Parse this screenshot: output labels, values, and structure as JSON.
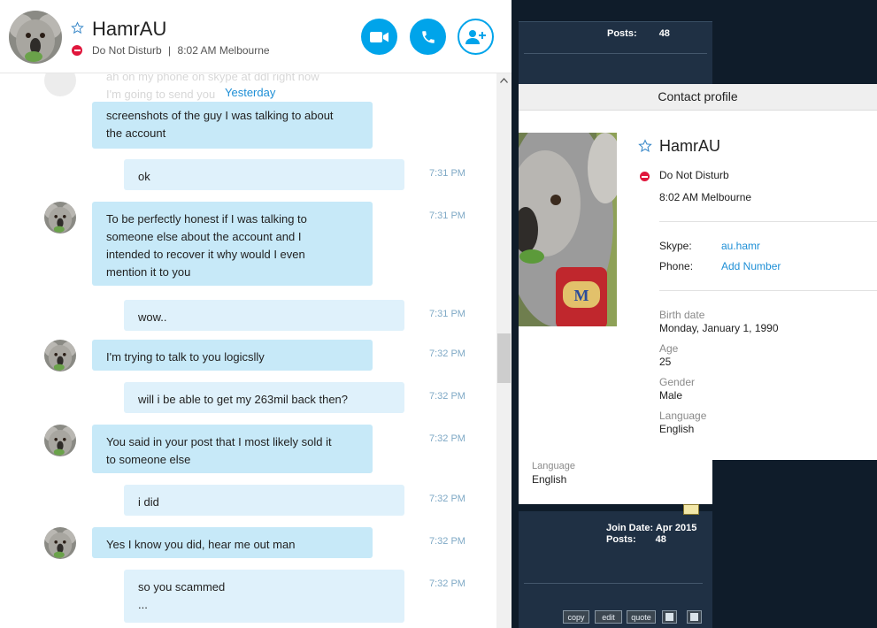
{
  "forum": {
    "top_posts_label": "Posts:",
    "top_posts_value": "48",
    "language_label": "Language",
    "language_value": "English",
    "join_date_label": "Join Date:",
    "join_date_value": "Apr 2015",
    "posts_label": "Posts:",
    "posts_value": "48",
    "buttons": [
      "copy",
      "edit",
      "quote"
    ]
  },
  "profile": {
    "header": "Contact profile",
    "name": "HamrAU",
    "status": "Do Not Disturb",
    "local_time": "8:02 AM Melbourne",
    "skype_label": "Skype:",
    "skype_value": "au.hamr",
    "phone_label": "Phone:",
    "phone_value": "Add Number",
    "birth_label": "Birth date",
    "birth_value": "Monday, January 1, 1990",
    "age_label": "Age",
    "age_value": "25",
    "gender_label": "Gender",
    "gender_value": "Male",
    "language_label": "Language",
    "language_value": "English"
  },
  "chat": {
    "contact_name": "HamrAU",
    "status": "Do Not Disturb",
    "local_time": "8:02 AM Melbourne",
    "status_separator": "|",
    "date_separator": "Yesterday",
    "faded_lines": [
      "ah on my phone on skype at ddl right now",
      "I'm going to send you"
    ],
    "messages": [
      {
        "dir": "in",
        "text": "screenshots of the guy I was talking to about\nthe account",
        "time": ""
      },
      {
        "dir": "out",
        "text": "ok",
        "time": "7:31 PM"
      },
      {
        "dir": "in",
        "text": "To be perfectly honest if I was talking to\nsomeone else about the account and I\nintended to recover it why would I even\nmention it to you",
        "time": "7:31 PM"
      },
      {
        "dir": "out",
        "text": "wow..",
        "time": "7:31 PM"
      },
      {
        "dir": "in",
        "text": "I'm trying to talk to you logicslly",
        "time": "7:32 PM"
      },
      {
        "dir": "out",
        "text": "will i be able to get my 263mil back then?",
        "time": "7:32 PM"
      },
      {
        "dir": "in",
        "text": "You said in your post that I most likely sold it\nto someone else",
        "time": "7:32 PM"
      },
      {
        "dir": "out",
        "text": "i did",
        "time": "7:32 PM"
      },
      {
        "dir": "in",
        "text": "Yes I know you did, hear me out man",
        "time": "7:32 PM"
      },
      {
        "dir": "out",
        "text": "so you scammed\n...",
        "time": "7:32 PM"
      }
    ]
  },
  "icons": {
    "favorite": "star-outline-icon",
    "video_call": "video-camera-icon",
    "voice_call": "phone-icon",
    "add_contact": "add-person-icon",
    "status": "do-not-disturb-icon"
  },
  "colors": {
    "accent": "#00a4ea",
    "incoming_bubble": "#c7e9f8",
    "outgoing_bubble": "#dff1fb",
    "dnd_red": "#e0163c",
    "link": "#1e8fd6"
  }
}
